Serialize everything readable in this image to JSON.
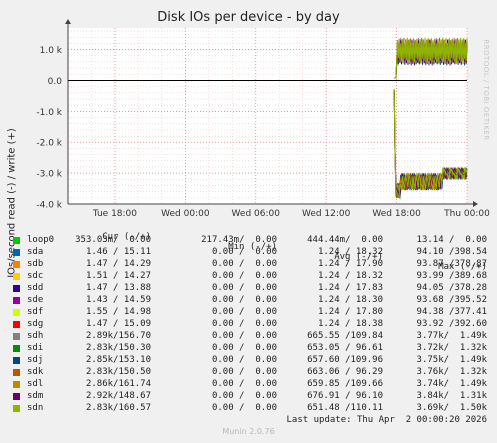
{
  "title": "Disk IOs per device - by day",
  "side_label": "RRDTOOL / TOBI OETIKER",
  "footer": "Munin 2.0.76",
  "legend_headers": [
    "Cur (-/+)",
    "Min (-/+)",
    "Avg (-/+)",
    "Max (-/+)"
  ],
  "legend": [
    {
      "name": "loop0",
      "color": "#00cc00",
      "cur": "353.03m/  0.00",
      "min": "217.43m/  0.00",
      "avg": "444.44m/  0.00",
      "max": "13.14 /  0.00"
    },
    {
      "name": "sda",
      "color": "#0066b3",
      "cur": "1.46 / 15.11",
      "min": "0.00 /  0.00",
      "avg": "1.24 / 18.32",
      "max": "94.10 /398.54"
    },
    {
      "name": "sdb",
      "color": "#ff8000",
      "cur": "1.47 / 14.29",
      "min": "0.00 /  0.00",
      "avg": "1.24 / 17.90",
      "max": "93.87 /378.87"
    },
    {
      "name": "sdc",
      "color": "#ffcc00",
      "cur": "1.51 / 14.27",
      "min": "0.00 /  0.00",
      "avg": "1.24 / 18.32",
      "max": "93.99 /389.68"
    },
    {
      "name": "sdd",
      "color": "#330099",
      "cur": "1.47 / 13.88",
      "min": "0.00 /  0.00",
      "avg": "1.24 / 17.83",
      "max": "94.05 /378.28"
    },
    {
      "name": "sde",
      "color": "#990099",
      "cur": "1.43 / 14.59",
      "min": "0.00 /  0.00",
      "avg": "1.24 / 18.30",
      "max": "93.68 /395.52"
    },
    {
      "name": "sdf",
      "color": "#ccff00",
      "cur": "1.55 / 14.98",
      "min": "0.00 /  0.00",
      "avg": "1.24 / 17.80",
      "max": "94.38 /377.41"
    },
    {
      "name": "sdg",
      "color": "#ff0000",
      "cur": "1.47 / 15.09",
      "min": "0.00 /  0.00",
      "avg": "1.24 / 18.38",
      "max": "93.92 /392.60"
    },
    {
      "name": "sdh",
      "color": "#808080",
      "cur": "2.89k/156.70",
      "min": "0.00 /  0.00",
      "avg": "665.55 /109.84",
      "max": "3.77k/  1.49k"
    },
    {
      "name": "sdi",
      "color": "#008f00",
      "cur": "2.83k/150.30",
      "min": "0.00 /  0.00",
      "avg": "653.05 / 96.61",
      "max": "3.72k/  1.32k"
    },
    {
      "name": "sdj",
      "color": "#00487d",
      "cur": "2.85k/153.10",
      "min": "0.00 /  0.00",
      "avg": "657.60 /109.96",
      "max": "3.75k/  1.49k"
    },
    {
      "name": "sdk",
      "color": "#b35a00",
      "cur": "2.83k/150.50",
      "min": "0.00 /  0.00",
      "avg": "663.06 / 96.29",
      "max": "3.76k/  1.32k"
    },
    {
      "name": "sdl",
      "color": "#b38f00",
      "cur": "2.86k/161.74",
      "min": "0.00 /  0.00",
      "avg": "659.85 /109.66",
      "max": "3.74k/  1.49k"
    },
    {
      "name": "sdm",
      "color": "#6b006b",
      "cur": "2.92k/148.67",
      "min": "0.00 /  0.00",
      "avg": "676.91 / 96.10",
      "max": "3.84k/  1.31k"
    },
    {
      "name": "sdn",
      "color": "#8fb300",
      "cur": "2.83k/160.57",
      "min": "0.00 /  0.00",
      "avg": "651.48 /110.11",
      "max": "3.69k/  1.50k"
    }
  ],
  "last_update": "Last update: Thu Apr  2 00:00:20 2026",
  "chart_data": {
    "type": "line",
    "title": "Disk IOs per device - by day",
    "ylabel": "IOs/second read (-) / write (+)",
    "ylim": [
      -4000,
      1700
    ],
    "yticks": [
      -4000,
      -3000,
      -2000,
      -1000,
      0,
      1000
    ],
    "ytick_labels": [
      "-4.0 k",
      "-3.0 k",
      "-2.0 k",
      "-1.0 k",
      "0.0",
      "1.0 k"
    ],
    "xlim": [
      -4,
      30
    ],
    "xticks": [
      0,
      6,
      12,
      18,
      24,
      30
    ],
    "xtick_labels": [
      "Tue 18:00",
      "Wed 00:00",
      "Wed 06:00",
      "Wed 12:00",
      "Wed 18:00",
      "Thu 00:00"
    ],
    "grid": true,
    "series_summary": {
      "start_hour": 23.8,
      "write_level_high": 1200,
      "write_level_low": 550,
      "read_spike_min": -3800,
      "read_level_mid": -3300,
      "read_level_end": -2850
    }
  }
}
